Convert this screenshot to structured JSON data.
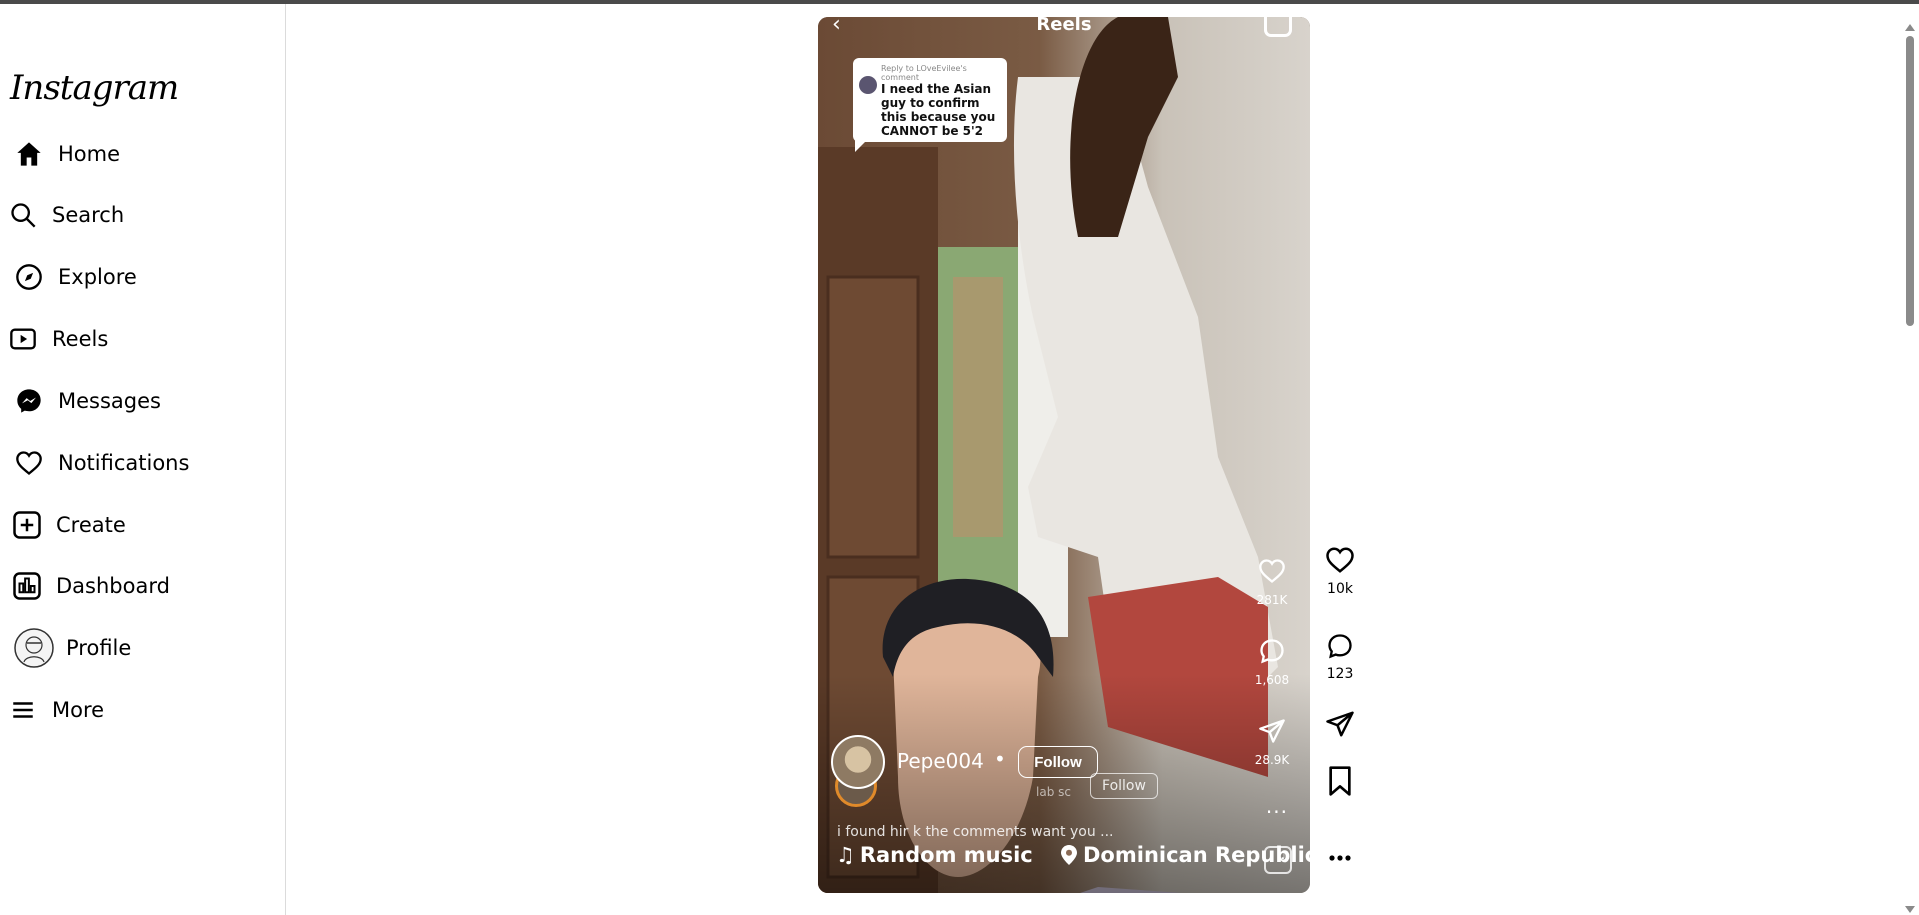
{
  "brand": {
    "logo": "Instagram"
  },
  "sidebar": {
    "items": [
      {
        "label": "Home",
        "icon": "home-icon"
      },
      {
        "label": "Search",
        "icon": "search-icon"
      },
      {
        "label": "Explore",
        "icon": "compass-icon"
      },
      {
        "label": "Reels",
        "icon": "reels-icon"
      },
      {
        "label": "Messages",
        "icon": "messenger-icon"
      },
      {
        "label": "Notifications",
        "icon": "heart-icon"
      },
      {
        "label": "Create",
        "icon": "plus-square-icon"
      },
      {
        "label": "Dashboard",
        "icon": "dashboard-icon"
      },
      {
        "label": "Profile",
        "icon": "avatar-icon"
      },
      {
        "label": "More",
        "icon": "hamburger-icon"
      }
    ]
  },
  "reel": {
    "header_title": "Reels",
    "comment_bubble": {
      "reply_to": "Reply to LOveEvilee's comment",
      "text": "I need the Asian guy to confirm this because you CANNOT be 5'2"
    },
    "embedded_stats": {
      "likes": "281K",
      "comments": "1,608",
      "shares": "28.9K"
    },
    "username": "Pepe004",
    "separator": "•",
    "follow_label": "Follow",
    "ghost_follow_label": "Follow",
    "ghost_tag": "lab sc",
    "caption": "i found hir          k the comments want you ...",
    "music_label": "Random music",
    "location_label": "Dominican Republic"
  },
  "actions": {
    "likes": "10k",
    "comments": "123"
  },
  "colors": {
    "ring": "#e08a2a",
    "scroll": "#8a8a8a",
    "border": "#dbdbdb"
  }
}
